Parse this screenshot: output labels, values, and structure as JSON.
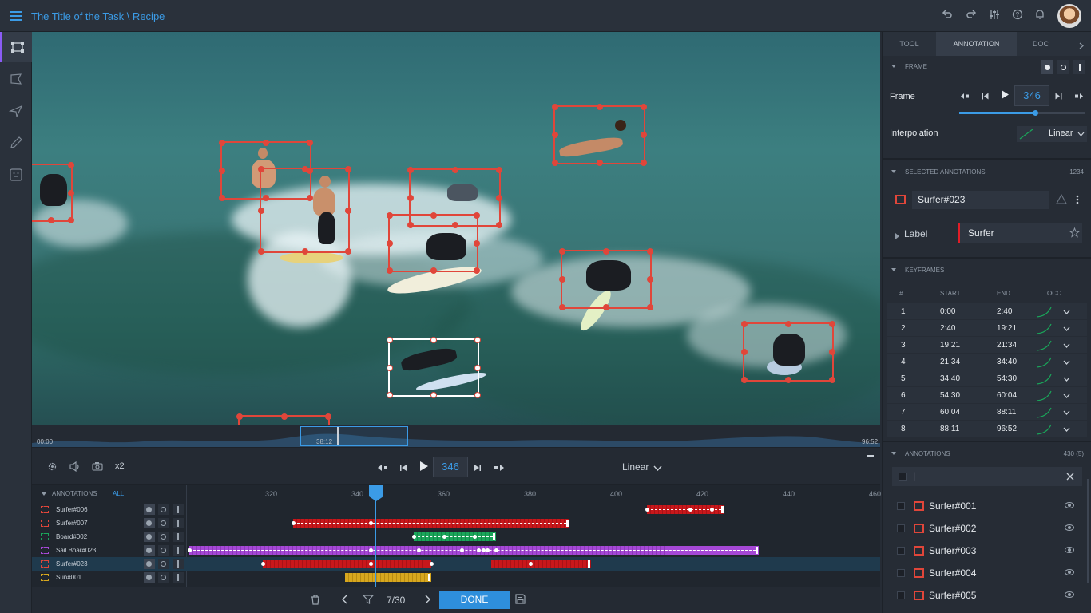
{
  "app": {
    "title": "The Title of the Task \\ Recipe"
  },
  "top_icons": [
    "undo-icon",
    "redo-icon",
    "sliders-icon",
    "help-icon",
    "bell-icon"
  ],
  "tools": [
    "bbox-tool-icon",
    "polygon-tool-icon",
    "point-tool-icon",
    "pencil-tool-icon",
    "face-tool-icon"
  ],
  "scrubber": {
    "start": "00:00",
    "current": "38:12",
    "end": "96:52"
  },
  "playback": {
    "speed": "x2",
    "frame": "346",
    "interpolation": "Linear"
  },
  "timeline": {
    "header": "ANNOTATIONS",
    "filter": "ALL",
    "ticks": [
      "320",
      "340",
      "360",
      "380",
      "400",
      "420",
      "440",
      "460"
    ],
    "playhead_frame": 346,
    "tracks": [
      {
        "name": "Surfer#006",
        "color": "#e0463a"
      },
      {
        "name": "Surfer#007",
        "color": "#e0463a"
      },
      {
        "name": "Board#002",
        "color": "#1aa65a"
      },
      {
        "name": "Sail Boar#023",
        "color": "#a548d6"
      },
      {
        "name": "Surfer#023",
        "color": "#e0463a"
      },
      {
        "name": "Sun#001",
        "color": "#d7a71e"
      }
    ]
  },
  "bottombar": {
    "page": "7/30",
    "done": "DONE"
  },
  "panel": {
    "tabs": [
      "TOOL",
      "ANNOTATION",
      "DOC"
    ],
    "frame_section": {
      "title": "FRAME",
      "frame_label": "Frame",
      "frame_value": "346",
      "frame_progress": 0.6,
      "interp_label": "Interpolation",
      "interp_value": "Linear"
    },
    "selected": {
      "title": "SELECTED ANNOTATIONS",
      "count": "1234",
      "name": "Surfer#023",
      "label_key": "Label",
      "label_value": "Surfer"
    },
    "keyframes": {
      "title": "KEYFRAMES",
      "columns": [
        "#",
        "START",
        "END",
        "OCC"
      ],
      "rows": [
        {
          "n": "1",
          "start": "0:00",
          "end": "2:40"
        },
        {
          "n": "2",
          "start": "2:40",
          "end": "19:21"
        },
        {
          "n": "3",
          "start": "19:21",
          "end": "21:34"
        },
        {
          "n": "4",
          "start": "21:34",
          "end": "34:40"
        },
        {
          "n": "5",
          "start": "34:40",
          "end": "54:30"
        },
        {
          "n": "6",
          "start": "54:30",
          "end": "60:04"
        },
        {
          "n": "7",
          "start": "60:04",
          "end": "88:11"
        },
        {
          "n": "8",
          "start": "88:11",
          "end": "96:52"
        }
      ]
    },
    "annotations": {
      "title": "ANNOTATIONS",
      "count": "430 (5)",
      "search_value": "|",
      "items": [
        "Surfer#001",
        "Surfer#002",
        "Surfer#003",
        "Surfer#004",
        "Surfer#005"
      ]
    }
  },
  "colors": {
    "accent": "#3b9be6",
    "bbox": "#e0463a",
    "selected": "#ffffff"
  }
}
